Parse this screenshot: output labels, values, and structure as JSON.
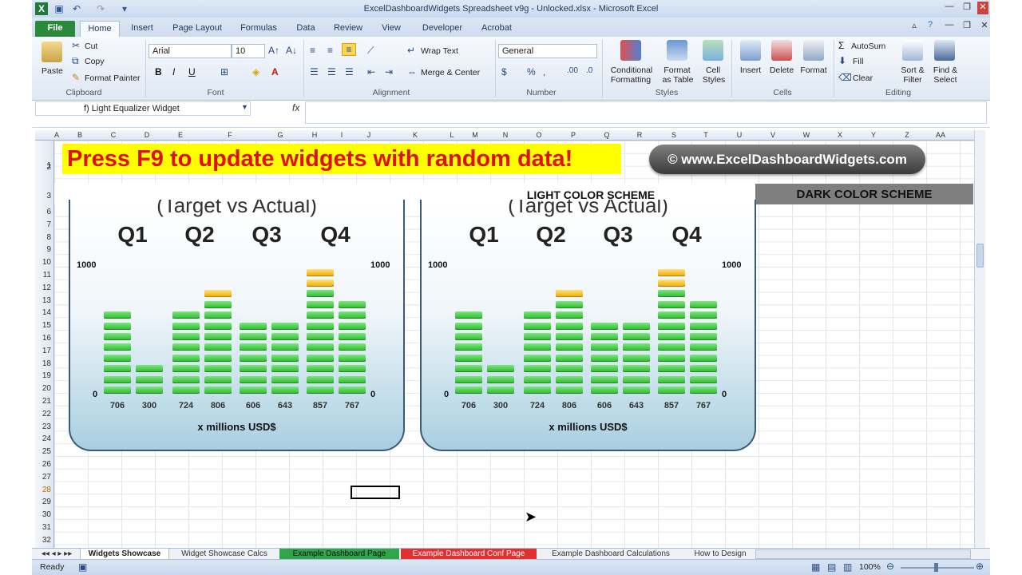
{
  "app": {
    "title": "ExcelDashboardWidgets Spreadsheet v9g - Unlocked.xlsx - Microsoft Excel"
  },
  "tabs": [
    "File",
    "Home",
    "Insert",
    "Page Layout",
    "Formulas",
    "Data",
    "Review",
    "View",
    "Developer",
    "Acrobat"
  ],
  "ribbon": {
    "clipboard": {
      "paste": "Paste",
      "cut": "Cut",
      "copy": "Copy",
      "format_painter": "Format Painter",
      "label": "Clipboard"
    },
    "font": {
      "name": "Arial",
      "size": "10",
      "label": "Font"
    },
    "alignment": {
      "wrap": "Wrap Text",
      "merge": "Merge & Center",
      "label": "Alignment"
    },
    "number": {
      "format": "General",
      "label": "Number"
    },
    "styles": {
      "conditional": "Conditional",
      "conditional2": "Formatting",
      "format_table": "Format",
      "format_table2": "as Table",
      "cell_styles": "Cell",
      "cell_styles2": "Styles",
      "label": "Styles"
    },
    "cells": {
      "insert": "Insert",
      "delete": "Delete",
      "format": "Format",
      "label": "Cells"
    },
    "editing": {
      "autosum": "AutoSum",
      "fill": "Fill",
      "clear": "Clear",
      "sort": "Sort &",
      "sort2": "Filter",
      "find": "Find &",
      "find2": "Select",
      "label": "Editing"
    }
  },
  "formula_bar": {
    "name_box": "f) Light Equalizer Widget",
    "fx": "fx"
  },
  "columns": [
    "A",
    "B",
    "C",
    "D",
    "E",
    "F",
    "G",
    "H",
    "I",
    "J",
    "K",
    "L",
    "M",
    "N",
    "O",
    "P",
    "Q",
    "R",
    "S",
    "T",
    "U",
    "V",
    "W",
    "X",
    "Y",
    "Z",
    "AA"
  ],
  "rows": [
    "1",
    "2",
    "3",
    "6",
    "7",
    "8",
    "9",
    "10",
    "11",
    "12",
    "13",
    "14",
    "15",
    "16",
    "17",
    "18",
    "19",
    "20",
    "21",
    "22",
    "23",
    "24",
    "25",
    "26",
    "27",
    "28",
    "29",
    "30",
    "31",
    "32"
  ],
  "banner": "Press F9 to update widgets with random data!",
  "website": "© www.ExcelDashboardWidgets.com",
  "scheme_light": "LIGHT COLOR SCHEME",
  "scheme_dark": "DARK COLOR SCHEME",
  "widget": {
    "title": "(Target vs Actual)",
    "quarters": [
      "Q1",
      "Q2",
      "Q3",
      "Q4"
    ],
    "axis_max": "1000",
    "axis_min": "0",
    "unit": "x millions USD$",
    "values": [
      "706",
      "300",
      "724",
      "806",
      "606",
      "643",
      "857",
      "767"
    ]
  },
  "chart_data": {
    "type": "bar",
    "categories": [
      "Q1",
      "Q1",
      "Q2",
      "Q2",
      "Q3",
      "Q3",
      "Q4",
      "Q4"
    ],
    "values": [
      706,
      300,
      724,
      806,
      606,
      643,
      857,
      767
    ],
    "targets_segments": [
      0,
      0,
      0,
      1,
      0,
      0,
      2,
      0
    ],
    "ylim": [
      0,
      1000
    ],
    "title": "(Target vs Actual)",
    "xlabel": "x millions USD$",
    "colors": {
      "actual": "#3cc83c",
      "target": "#f5b400"
    }
  },
  "sheet_tabs": [
    "Widgets Showcase",
    "Widget Showcase Calcs",
    "Example Dashboard Page",
    "Example Dashboard Conf Page",
    "Example Dashboard Calculations",
    "How to Design"
  ],
  "status": {
    "ready": "Ready",
    "zoom": "100%"
  },
  "colors": {
    "banner_bg": "#ffff00",
    "banner_text": "#e01010",
    "file_tab": "#2a8a3a"
  }
}
